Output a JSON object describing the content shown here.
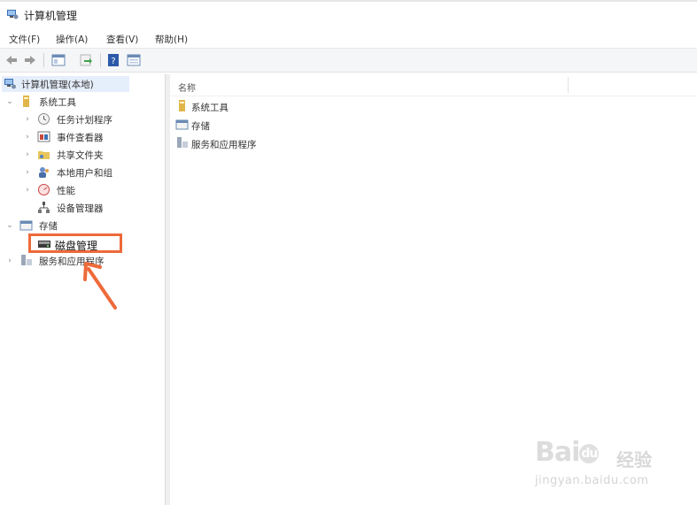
{
  "window": {
    "title": "计算机管理",
    "icon": "computer-management-icon"
  },
  "menu": [
    "文件(F)",
    "操作(A)",
    "查看(V)",
    "帮助(H)"
  ],
  "toolbar": {
    "buttons": [
      "back-arrow-icon",
      "forward-arrow-icon",
      "console-tree-icon",
      "export-icon",
      "help-icon",
      "properties-icon"
    ]
  },
  "tree": {
    "root": "计算机管理(本地)",
    "system_tools": {
      "label": "系统工具",
      "children": [
        "任务计划程序",
        "事件查看器",
        "共享文件夹",
        "本地用户和组",
        "性能",
        "设备管理器"
      ]
    },
    "storage": {
      "label": "存储",
      "children": [
        "磁盘管理"
      ]
    },
    "services": {
      "label": "服务和应用程序"
    }
  },
  "list": {
    "column_name": "名称",
    "items": [
      "系统工具",
      "存储",
      "服务和应用程序"
    ]
  },
  "watermark": {
    "brand": "Bai",
    "brand2": "du",
    "cn": "经验",
    "url": "jingyan.baidu.com"
  },
  "colors": {
    "highlight": "#ee6a3a",
    "selection": "#e5eefb"
  }
}
